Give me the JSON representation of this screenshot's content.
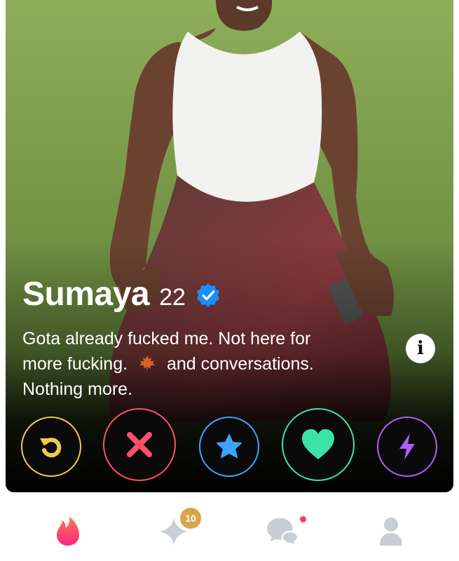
{
  "profile": {
    "name": "Sumaya",
    "age": "22",
    "verified": true,
    "bio_line_1": "Gota already fucked me. Not here for",
    "bio_line_2a": "more fucking.",
    "bio_emoji": "maple-leaf",
    "bio_line_2b": "and conversations.",
    "bio_line_3": "Nothing more.",
    "info_button_label": "i"
  },
  "actions": [
    {
      "name": "rewind",
      "icon": "rewind-icon",
      "color": "#f3c94b"
    },
    {
      "name": "nope",
      "icon": "close-icon",
      "color": "#fd5068"
    },
    {
      "name": "super-like",
      "icon": "star-icon",
      "color": "#3ca4ff"
    },
    {
      "name": "like",
      "icon": "heart-icon",
      "color": "#3de3a6"
    },
    {
      "name": "boost",
      "icon": "bolt-icon",
      "color": "#b25cff"
    }
  ],
  "nav": {
    "items": [
      {
        "name": "discover",
        "icon": "flame-icon",
        "active": true
      },
      {
        "name": "gold",
        "icon": "sparkle-icon",
        "badge": "10"
      },
      {
        "name": "messages",
        "icon": "chat-bubbles-icon",
        "has_dot": true
      },
      {
        "name": "profile",
        "icon": "person-icon"
      }
    ]
  },
  "colors": {
    "brand": "#fd5068",
    "badge_gold": "#d7a54a",
    "inactive": "#c9cdd4"
  }
}
